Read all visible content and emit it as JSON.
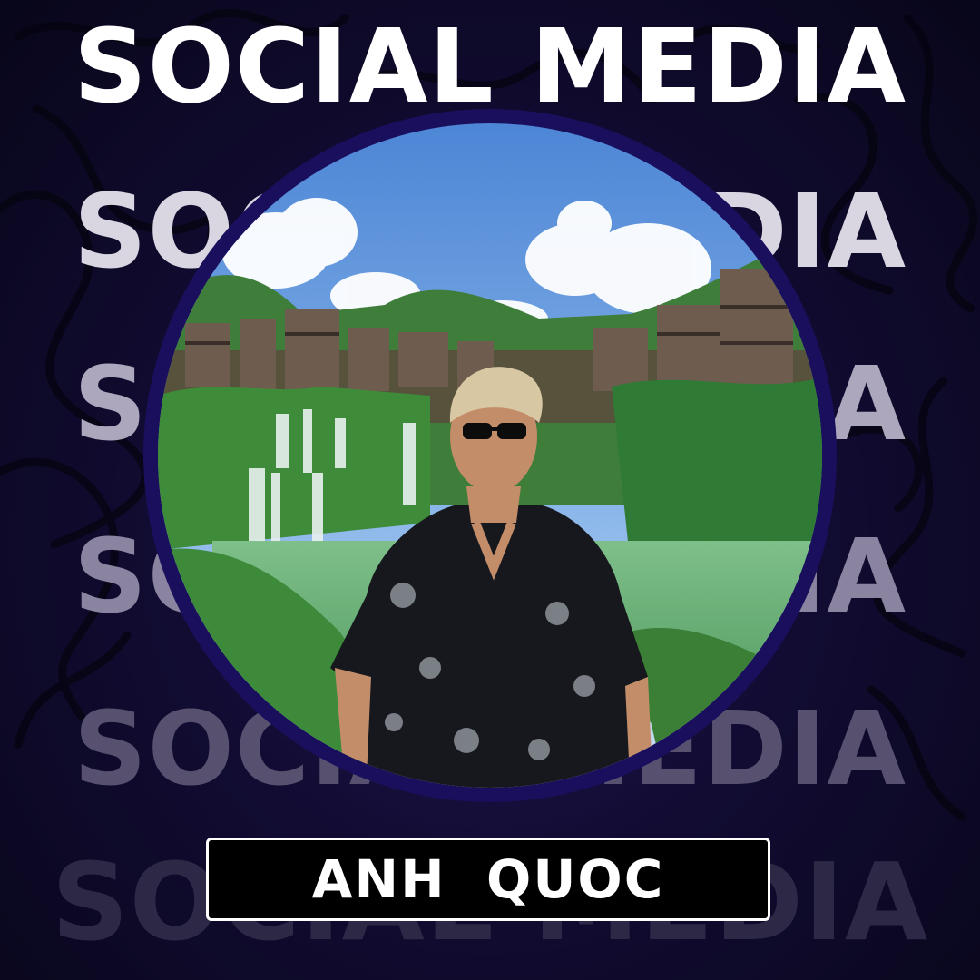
{
  "poster": {
    "title": "SOCIAL MEDIA",
    "echo_titles": [
      "SOCIAL MEDIA",
      "SOCIAL MEDIA",
      "SOCIAL MEDIA",
      "SOCIAL MEDIA",
      "SOCIAL MEDIA"
    ],
    "name": "ANH  QUOC"
  },
  "colors": {
    "background_dark": "#08061a",
    "background_mid": "#1e1550",
    "ring": "#1a0f5c",
    "title": "#ffffff",
    "name_box": "#000000",
    "name_border": "#ffffff"
  },
  "photo": {
    "subject": "man-with-sunglasses-icon",
    "scene": "waterfall-village-landscape"
  }
}
